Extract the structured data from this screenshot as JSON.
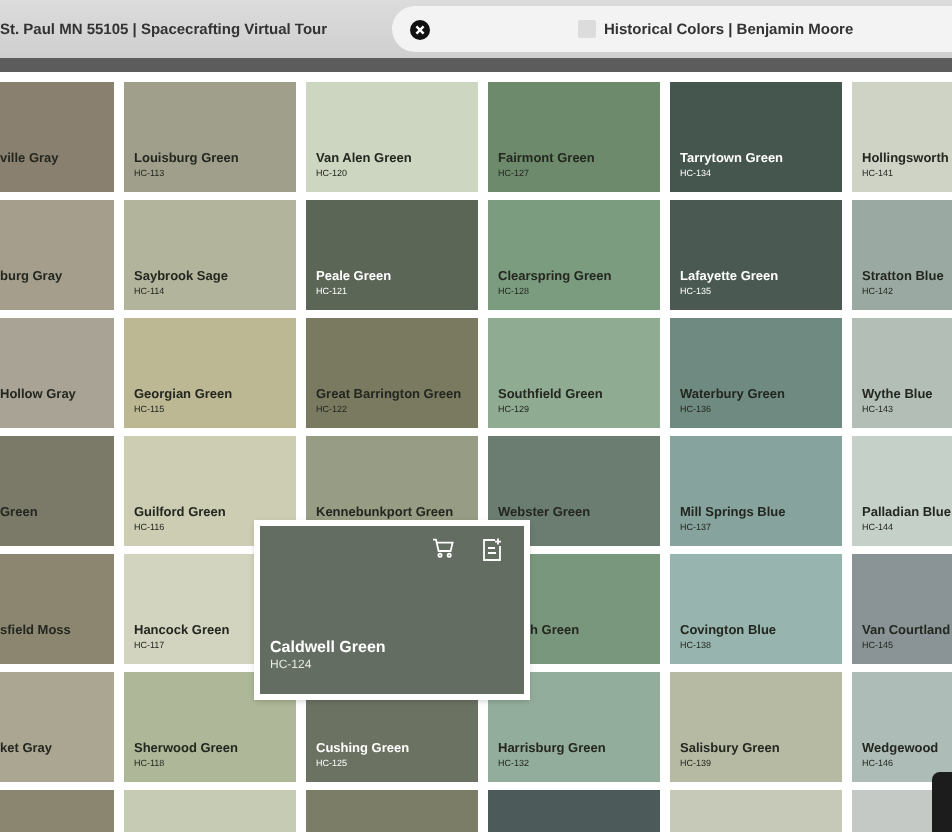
{
  "tabs": [
    {
      "title": "St. Paul MN 55105 | Spacecrafting Virtual Tour",
      "selected": false
    },
    {
      "title": "Historical Colors | Benjamin Moore",
      "selected": true
    }
  ],
  "swatch_rows": [
    [
      {
        "kind": "swatch",
        "name": "ville Gray",
        "color": "#8a8070"
      },
      {
        "kind": "swatch",
        "name": "Louisburg Green",
        "code": "HC-113",
        "color": "#a09f8b"
      },
      {
        "kind": "swatch",
        "name": "Van Alen Green",
        "code": "HC-120",
        "color": "#cdd6c0"
      },
      {
        "kind": "swatch",
        "name": "Fairmont Green",
        "code": "HC-127",
        "color": "#6e8a6c"
      },
      {
        "kind": "swatch",
        "name": "Tarrytown Green",
        "code": "HC-134",
        "color": "#45564f"
      },
      {
        "kind": "swatch",
        "name": "Hollingsworth",
        "code": "HC-141",
        "color": "#cfd3c6"
      }
    ],
    [
      {
        "kind": "swatch",
        "name": "burg Gray",
        "color": "#a59e8c"
      },
      {
        "kind": "swatch",
        "name": "Saybrook Sage",
        "code": "HC-114",
        "color": "#b3b49c"
      },
      {
        "kind": "swatch",
        "name": "Peale Green",
        "code": "HC-121",
        "color": "#5b6656"
      },
      {
        "kind": "swatch",
        "name": "Clearspring Green",
        "code": "HC-128",
        "color": "#7c9c80"
      },
      {
        "kind": "swatch",
        "name": "Lafayette Green",
        "code": "HC-135",
        "color": "#4a5a52"
      },
      {
        "kind": "swatch",
        "name": "Stratton Blue",
        "code": "HC-142",
        "color": "#9aaaa3"
      }
    ],
    [
      {
        "kind": "swatch",
        "name": "Hollow Gray",
        "color": "#a9a395"
      },
      {
        "kind": "swatch",
        "name": "Georgian Green",
        "code": "HC-115",
        "color": "#bcb894"
      },
      {
        "kind": "swatch",
        "name": "Great Barrington Green",
        "code": "HC-122",
        "color": "#7a7a60"
      },
      {
        "kind": "swatch",
        "name": "Southfield Green",
        "code": "HC-129",
        "color": "#8fac92"
      },
      {
        "kind": "swatch",
        "name": "Waterbury Green",
        "code": "HC-136",
        "color": "#6f8a80"
      },
      {
        "kind": "swatch",
        "name": "Wythe Blue",
        "code": "HC-143",
        "color": "#b3bfb6"
      }
    ],
    [
      {
        "kind": "swatch",
        "name": "Green",
        "color": "#7b7a68"
      },
      {
        "kind": "swatch",
        "name": "Guilford Green",
        "code": "HC-116",
        "color": "#cccdb2"
      },
      {
        "kind": "swatch",
        "name": "Kennebunkport Green",
        "color": "#979c84"
      },
      {
        "kind": "swatch",
        "name": "Webster Green",
        "color": "#6b7c70"
      },
      {
        "kind": "swatch",
        "name": "Mill Springs Blue",
        "code": "HC-137",
        "color": "#86a39d"
      },
      {
        "kind": "swatch",
        "name": "Palladian Blue",
        "code": "HC-144",
        "color": "#c5d0c9"
      }
    ],
    [
      {
        "kind": "swatch",
        "name": "sfield Moss",
        "color": "#8c8670"
      },
      {
        "kind": "swatch",
        "name": "Hancock Green",
        "code": "HC-117",
        "color": "#d2d4bf"
      },
      {
        "kind": "enlarged",
        "name": "Caldwell Green",
        "code": "HC-124",
        "color": "#646d62"
      },
      {
        "kind": "covered",
        "name": "h Green",
        "color": "#79977d"
      },
      {
        "kind": "swatch",
        "name": "Covington Blue",
        "code": "HC-138",
        "color": "#98b4ae"
      },
      {
        "kind": "swatch",
        "name": "Van Courtland",
        "code": "HC-145",
        "color": "#8a9496"
      }
    ],
    [
      {
        "kind": "swatch",
        "name": "ket Gray",
        "color": "#aaa692"
      },
      {
        "kind": "swatch",
        "name": "Sherwood Green",
        "code": "HC-118",
        "color": "#aeb797"
      },
      {
        "kind": "swatch",
        "name": "Cushing Green",
        "code": "HC-125",
        "color": "#6b7262"
      },
      {
        "kind": "swatch",
        "name": "Harrisburg Green",
        "code": "HC-132",
        "color": "#93ad9c"
      },
      {
        "kind": "swatch",
        "name": "Salisbury Green",
        "code": "HC-139",
        "color": "#b7baa3"
      },
      {
        "kind": "swatch",
        "name": "Wedgewood",
        "code": "HC-146",
        "color": "#aebcb8"
      }
    ],
    [
      {
        "kind": "swatch",
        "color": "#8a8670"
      },
      {
        "kind": "swatch",
        "color": "#c6cbb3"
      },
      {
        "kind": "swatch",
        "color": "#7b7d66"
      },
      {
        "kind": "swatch",
        "color": "#4c5a5a"
      },
      {
        "kind": "swatch",
        "color": "#c7c9b8"
      },
      {
        "kind": "swatch",
        "color": "#c5c9c6"
      }
    ]
  ]
}
